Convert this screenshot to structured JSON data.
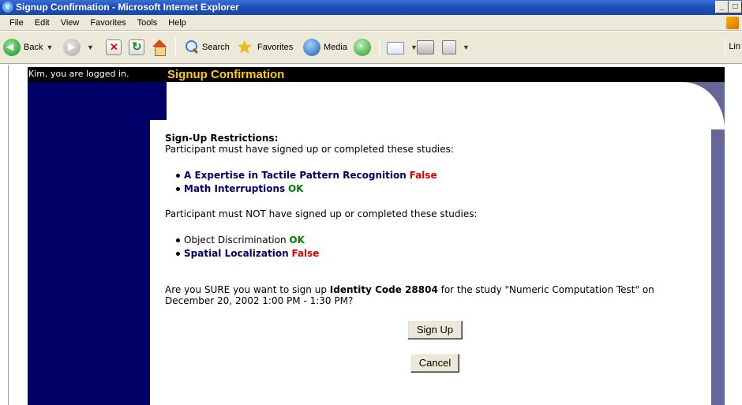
{
  "window": {
    "title": "Signup Confirmation - Microsoft Internet Explorer",
    "min_btn": "_",
    "max_btn": "□"
  },
  "menu": {
    "items": [
      {
        "label": "File"
      },
      {
        "label": "Edit"
      },
      {
        "label": "View"
      },
      {
        "label": "Favorites"
      },
      {
        "label": "Tools"
      },
      {
        "label": "Help"
      }
    ]
  },
  "toolbar": {
    "back": "Back",
    "search": "Search",
    "favorites": "Favorites",
    "media": "Media",
    "links": "Lin"
  },
  "page": {
    "logged_in": "Kim, you are logged in.",
    "title": "Signup Confirmation",
    "restrictions_title": "Sign-Up Restrictions:",
    "required_intro": "Participant must have signed up or completed these studies:",
    "required": [
      {
        "study": "A Expertise in Tactile Pattern Recognition",
        "status": "False"
      },
      {
        "study": "Math Interruptions",
        "status": "OK"
      }
    ],
    "excluded_intro": "Participant must NOT have signed up or completed these studies:",
    "excluded": [
      {
        "study": "Object Discrimination",
        "status": "OK"
      },
      {
        "study": "Spatial Localization",
        "status": "False"
      }
    ],
    "confirm_prefix": "Are you SURE you want to sign up ",
    "identity_code": "Identity Code 28804",
    "confirm_middle": " for the study \"Numeric Computation Test\" on",
    "confirm_date": "December 20, 2002 1:00 PM - 1:30 PM?",
    "signup_button": "Sign Up",
    "cancel_button": "Cancel"
  },
  "colors": {
    "nav": "#000066",
    "side": "#66669a",
    "title": "#ffcc00",
    "false": "#e00000",
    "ok": "#008000"
  }
}
